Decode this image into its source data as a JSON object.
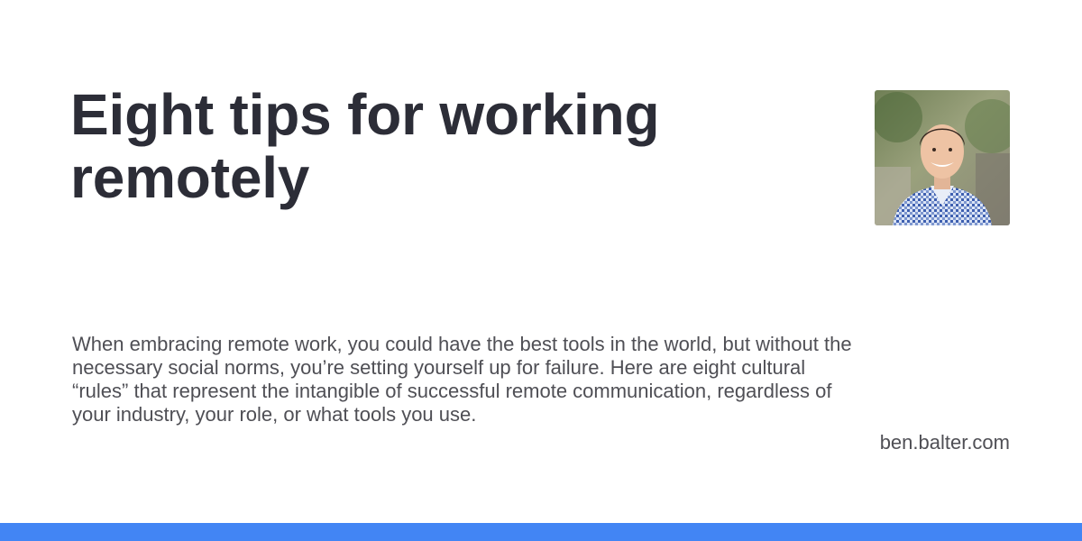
{
  "card": {
    "title": "Eight tips for working remotely",
    "description": "When embracing remote work, you could have the best tools in the world, but without the necessary social norms, you’re setting yourself up for failure. Here are eight cultural “rules” that represent the intangible of successful remote communication, regardless of your industry, your role, or what tools you use.",
    "site": "ben.balter.com",
    "avatar_icon": "author-photo",
    "accent_color": "#4285f4",
    "title_color": "#2c2d37",
    "text_color": "#4f4f55"
  }
}
